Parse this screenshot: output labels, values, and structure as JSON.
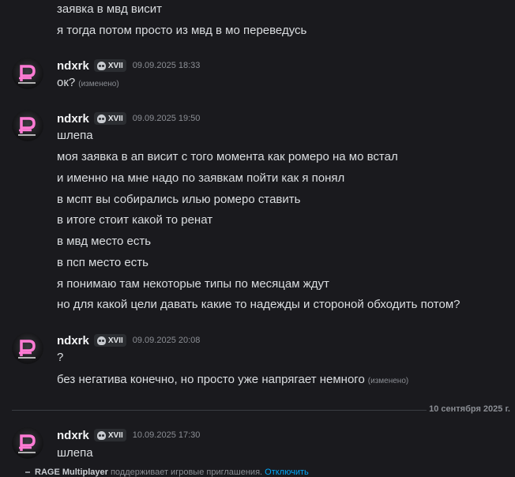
{
  "prev_lines": [
    "заявка в мвд висит",
    "я тогда потом просто из мвд в мо переведусь"
  ],
  "messages": [
    {
      "author": "ndxrk",
      "tag": "XVII",
      "time": "09.09.2025 18:33",
      "lines": [
        {
          "text": "ок?",
          "edited": "(изменено)"
        }
      ]
    },
    {
      "author": "ndxrk",
      "tag": "XVII",
      "time": "09.09.2025 19:50",
      "lines": [
        {
          "text": "шлепа"
        },
        {
          "text": "моя заявка в ап висит с того момента как ромеро на мо встал"
        },
        {
          "text": "и именно на мне надо по заявкам пойти как я понял"
        },
        {
          "text": "в мспт вы собирались илью ромеро ставить"
        },
        {
          "text": "в итоге стоит какой то ренат"
        },
        {
          "text": "в мвд место есть"
        },
        {
          "text": "в псп место есть"
        },
        {
          "text": "я понимаю там некоторые типы по месяцам ждут"
        },
        {
          "text": "но для какой цели давать какие то надежды и стороной обходить потом?"
        }
      ]
    },
    {
      "author": "ndxrk",
      "tag": "XVII",
      "time": "09.09.2025 20:08",
      "lines": [
        {
          "text": "?"
        },
        {
          "text": "без негатива конечно, но просто уже напрягает немного",
          "edited": "(изменено)"
        }
      ]
    },
    {
      "author": "ndxrk",
      "tag": "XVII",
      "time": "10.09.2025 17:30",
      "lines": [
        {
          "text": "шлепа"
        }
      ]
    }
  ],
  "date_divider": "10 сентября 2025 г.",
  "system_notice": {
    "app": "RAGE Multiplayer",
    "text": "поддерживает игровые приглашения.",
    "link": "Отключить"
  },
  "colors": {
    "background": "#1a1a1e",
    "text": "#dbdee1",
    "muted": "#8b8e94",
    "link": "#00a8fc",
    "avatar_accent": "#ff7bd5"
  }
}
